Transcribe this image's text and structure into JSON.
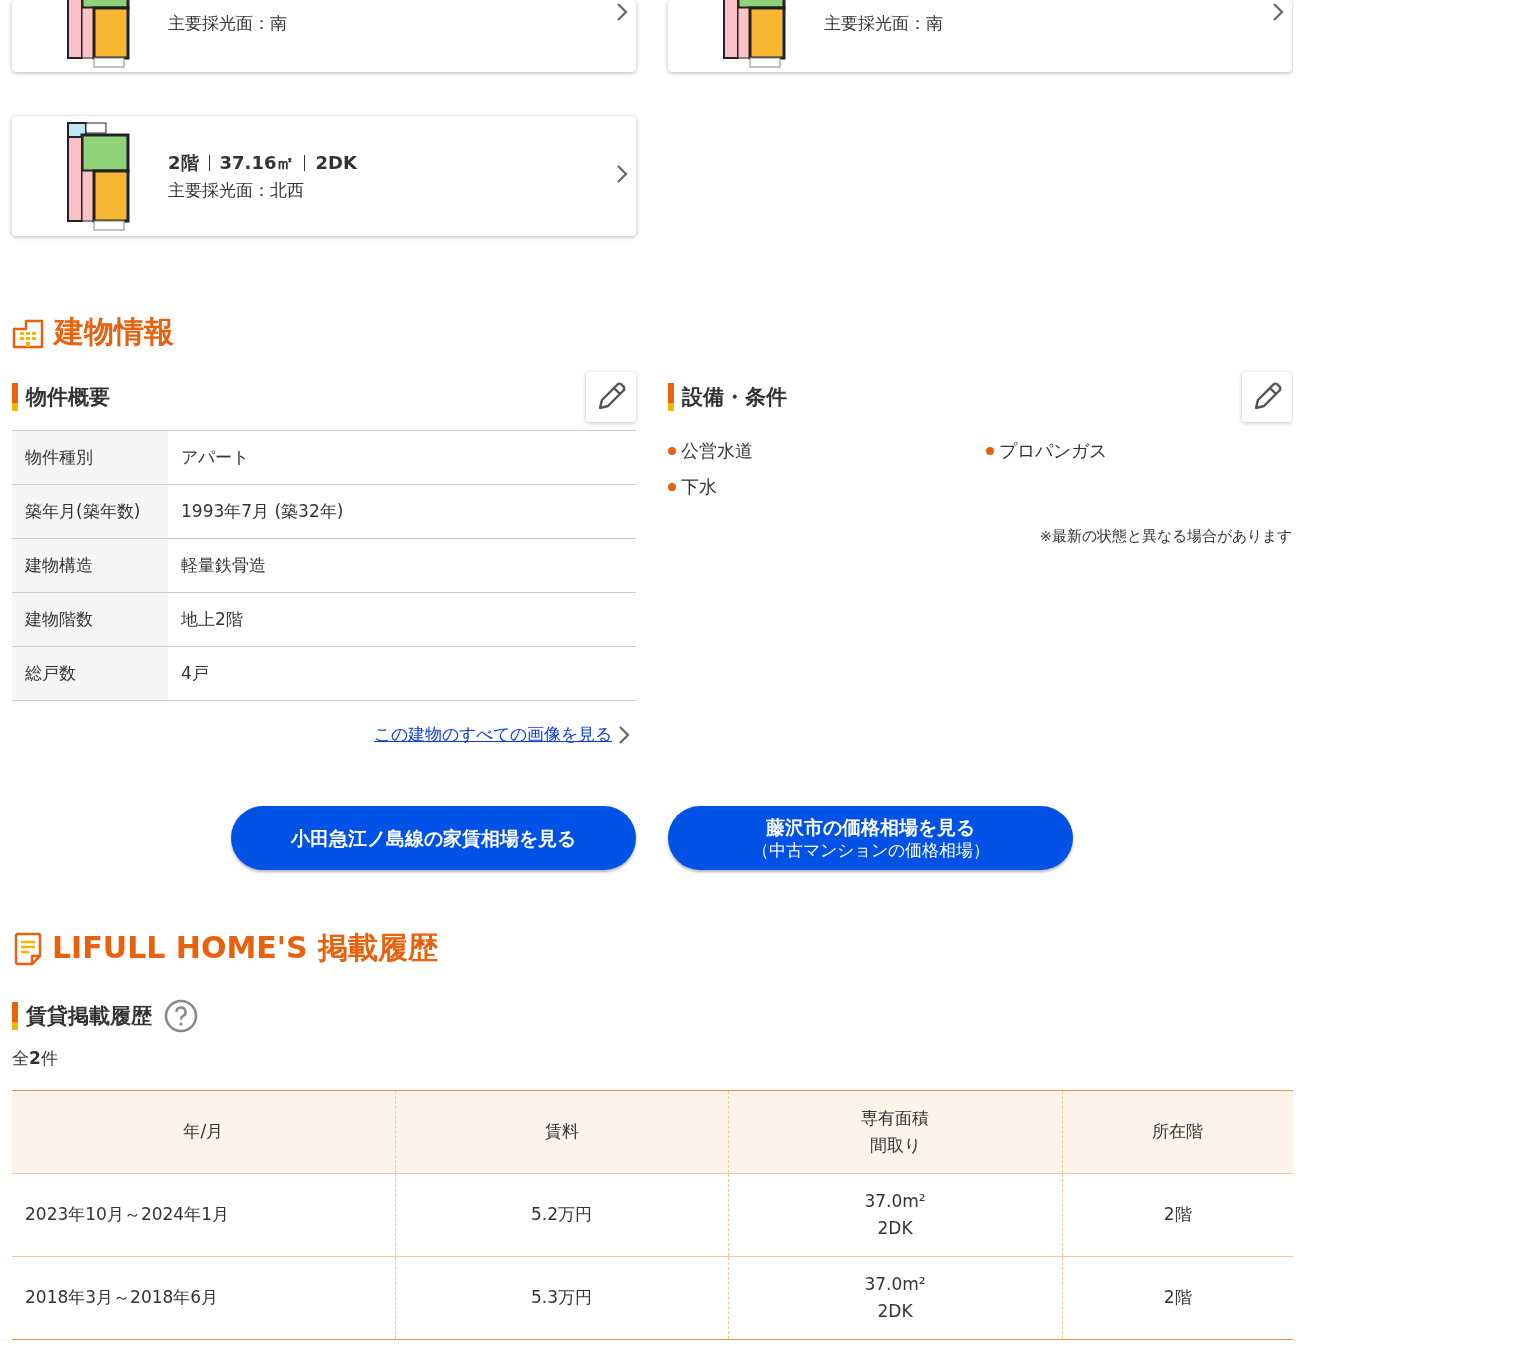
{
  "floor_plans": [
    {
      "lighting": "主要採光面：南"
    },
    {
      "lighting": "主要採光面：南"
    },
    {
      "summary": [
        "2階",
        "37.16㎡",
        "2DK"
      ],
      "lighting": "主要採光面：北西"
    }
  ],
  "building_info": {
    "title": "建物情報",
    "overview": {
      "title": "物件概要",
      "rows": [
        {
          "label": "物件種別",
          "value": "アパート"
        },
        {
          "label": "築年月(築年数)",
          "value": "1993年7月 (築32年)"
        },
        {
          "label": "建物構造",
          "value": "軽量鉄骨造"
        },
        {
          "label": "建物階数",
          "value": "地上2階"
        },
        {
          "label": "総戸数",
          "value": "4戸"
        }
      ],
      "link": "この建物のすべての画像を見る"
    },
    "facilities": {
      "title": "設備・条件",
      "items": [
        "公営水道",
        "プロパンガス",
        "下水"
      ],
      "note": "※最新の状態と異なる場合があります"
    }
  },
  "buttons": [
    {
      "label": "小田急江ノ島線の家賃相場を見る"
    },
    {
      "label": "藤沢市の価格相場を見る",
      "sub": "（中古マンションの価格相場）"
    }
  ],
  "history": {
    "title": "LIFULL HOME'S 掲載履歴",
    "subtitle": "賃貸掲載履歴",
    "count": "全**2**件",
    "columns": [
      {
        "label": "年/月"
      },
      {
        "label": "賃料"
      },
      {
        "label": "専有面積",
        "label_2": "間取り"
      },
      {
        "label": "所在階"
      }
    ],
    "rows": [
      {
        "period": "2023年10月～2024年1月",
        "rent": "5.2万円",
        "area": "37.0m²",
        "layout": "2DK",
        "floor": "2階"
      },
      {
        "period": "2018年3月～2018年6月",
        "rent": "5.3万円",
        "area": "37.0m²",
        "layout": "2DK",
        "floor": "2階"
      }
    ]
  }
}
